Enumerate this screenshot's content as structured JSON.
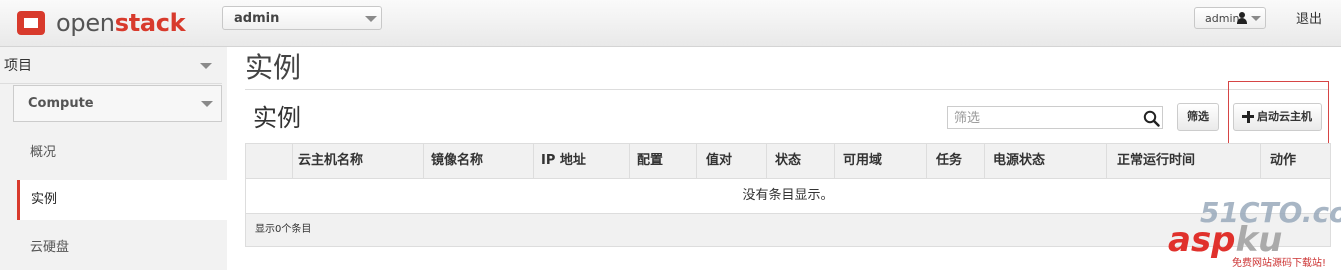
{
  "topbar": {
    "logo": {
      "part1": "open",
      "part2": "stack"
    },
    "project_select": {
      "value": "admin"
    },
    "user_menu": {
      "label": "admin"
    },
    "logout_label": "退出"
  },
  "sidebar": {
    "header_label": "项目",
    "compute_label": "Compute",
    "items": [
      {
        "label": "概况",
        "active": false
      },
      {
        "label": "实例",
        "active": true
      },
      {
        "label": "云硬盘",
        "active": false
      }
    ]
  },
  "main": {
    "page_title": "实例",
    "section_title": "实例",
    "filter": {
      "placeholder": "筛选",
      "button_label": "筛选"
    },
    "launch_button_label": "启动云主机",
    "table": {
      "columns": [
        "云主机名称",
        "镜像名称",
        "IP 地址",
        "配置",
        "值对",
        "状态",
        "可用域",
        "任务",
        "电源状态",
        "正常运行时间",
        "动作"
      ],
      "empty_message": "没有条目显示。",
      "footer_text": "显示0个条目"
    }
  },
  "watermark": {
    "line1": "51CTO.com",
    "line2a": "asp",
    "line2b": "ku",
    "line3": "免费网站源码下载站!"
  },
  "colors": {
    "accent": "#d83a2c",
    "highlight_box": "#d64545",
    "table_header_bg": "#f1f1f1"
  }
}
